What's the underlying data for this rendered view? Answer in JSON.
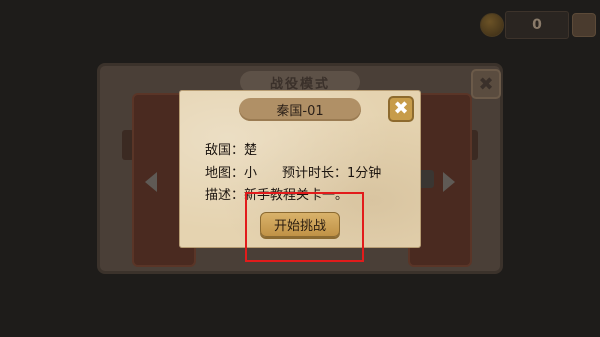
{
  "hud": {
    "counter_value": "0",
    "coin_icon": "coin-icon",
    "shop_icon": "shop-icon"
  },
  "background_panel": {
    "title": "战役模式",
    "close_label": "✖"
  },
  "dialog": {
    "title": "秦国-01",
    "close_label": "✖",
    "enemy_label": "敌国：",
    "enemy_value": "楚",
    "map_label": "地图：",
    "map_value": "小",
    "duration_label": "预计时长：",
    "duration_value": "1分钟",
    "desc_label": "描述：",
    "desc_value": "新手教程关卡一。",
    "start_button_label": "开始挑战"
  },
  "colors": {
    "highlight_box": "#e21b1b",
    "dialog_bg": "#e5d3b0",
    "button_gold": "#c79c4a"
  }
}
